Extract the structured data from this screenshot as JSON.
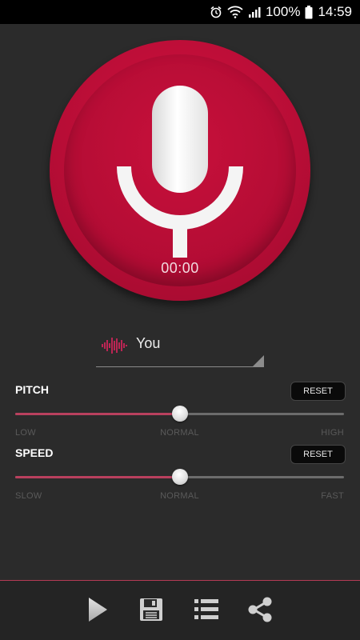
{
  "status_bar": {
    "battery": "100%",
    "time": "14:59",
    "icons": [
      "alarm-icon",
      "wifi-icon",
      "signal-icon",
      "battery-icon"
    ]
  },
  "recorder": {
    "timer": "00:00",
    "icon": "microphone-icon",
    "colors": {
      "button": "#c0103a",
      "accent": "#e0245e"
    }
  },
  "voice": {
    "selected": "You",
    "icon": "waveform-icon"
  },
  "pitch": {
    "label": "PITCH",
    "reset_label": "RESET",
    "value": 0.5,
    "scale": {
      "low": "LOW",
      "mid": "NORMAL",
      "high": "HIGH"
    }
  },
  "speed": {
    "label": "SPEED",
    "reset_label": "RESET",
    "value": 0.5,
    "scale": {
      "low": "SLOW",
      "mid": "NORMAL",
      "high": "FAST"
    }
  },
  "toolbar": {
    "icons": [
      "play-icon",
      "save-icon",
      "list-icon",
      "share-icon"
    ]
  }
}
